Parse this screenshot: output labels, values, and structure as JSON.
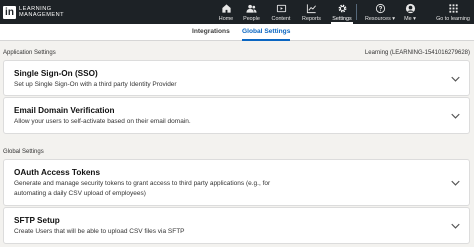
{
  "app": {
    "logo_mark": "in",
    "logo_line1": "LEARNING",
    "logo_line2": "MANAGEMENT"
  },
  "nav": {
    "items": [
      {
        "label": "Home",
        "icon": "home-icon"
      },
      {
        "label": "People",
        "icon": "people-icon"
      },
      {
        "label": "Content",
        "icon": "content-icon"
      },
      {
        "label": "Reports",
        "icon": "reports-icon"
      },
      {
        "label": "Settings",
        "icon": "gear-icon",
        "active": true
      },
      {
        "label": "Resources ▾",
        "icon": "help-icon"
      },
      {
        "label": "Me ▾",
        "icon": "avatar-icon"
      },
      {
        "label": "Go to learning",
        "icon": "grid-icon"
      }
    ]
  },
  "subtabs": {
    "integrations": "Integrations",
    "global_settings": "Global Settings",
    "active": "Global Settings"
  },
  "application_settings": {
    "label": "Application Settings",
    "account_id": "Learning (LEARNING-1541016279628)",
    "cards": [
      {
        "title": "Single Sign-On (SSO)",
        "description": "Set up Single Sign-On with a third party Identity Provider"
      },
      {
        "title": "Email Domain Verification",
        "description": "Allow your users to self-activate based on their email domain."
      }
    ]
  },
  "global_settings": {
    "label": "Global Settings",
    "cards": [
      {
        "title": "OAuth Access Tokens",
        "description_line1": "Generate and manage security tokens to grant access to third party applications (e.g., for",
        "description_line2": "automating a daily CSV upload of employees)"
      },
      {
        "title": "SFTP Setup",
        "description": "Create Users that will be able to upload CSV files via SFTP"
      }
    ]
  },
  "colors": {
    "nav_bg": "#1d2226",
    "accent": "#0a66c2",
    "page_bg": "#f3f2ef"
  }
}
